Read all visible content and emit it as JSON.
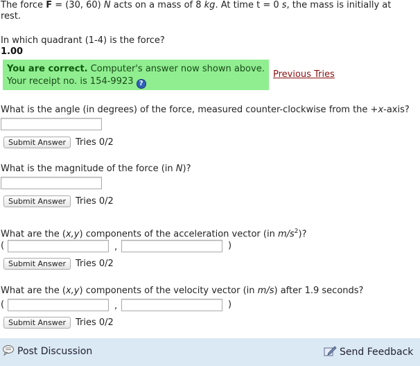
{
  "problem": {
    "line1_pre": "The force ",
    "force_symbol": "F",
    "line1_mid": " = (30, 60) ",
    "force_unit": "N",
    "line1_mid2": " acts on a mass of 8 ",
    "mass_unit": "kg",
    "line1_mid3": ". At time t = 0 ",
    "time_unit": "s",
    "line1_post": ", the mass is initially at",
    "line2": "rest."
  },
  "q1": {
    "question": "In which quadrant (1-4) is the force?",
    "answer": "1.00",
    "feedback_strong": "You are correct.",
    "feedback_rest": " Computer's answer now shown above.",
    "receipt": "Your receipt no. is 154-9923",
    "help_glyph": "?",
    "previous_tries": "Previous Tries"
  },
  "q2": {
    "question_pre": "What is the angle (in degrees) of the force, measured counter-clockwise from the +",
    "axis_var": "x",
    "question_post": "-axis?",
    "input_value": "",
    "submit_label": "Submit Answer",
    "tries": "Tries 0/2"
  },
  "q3": {
    "question_pre": "What is the magnitude of the force (in ",
    "unit": "N",
    "question_post": ")?",
    "input_value": "",
    "submit_label": "Submit Answer",
    "tries": "Tries 0/2"
  },
  "q4": {
    "question_pre": "What are the (",
    "vars": "x,y",
    "question_mid": ") components of the acceleration vector (in ",
    "unit_base": "m/s",
    "unit_exp": "2",
    "question_post": ")?",
    "open_paren": "(",
    "comma": ",",
    "close_paren": ")",
    "input_x": "",
    "input_y": "",
    "submit_label": "Submit Answer",
    "tries": "Tries 0/2"
  },
  "q5": {
    "question_pre": "What are the (",
    "vars": "x,y",
    "question_mid": ") components of the velocity vector (in ",
    "unit": "m/s",
    "question_post": ") after 1.9 seconds?",
    "open_paren": "(",
    "comma": ",",
    "close_paren": ")",
    "input_x": "",
    "input_y": "",
    "submit_label": "Submit Answer",
    "tries": "Tries 0/2"
  },
  "footer": {
    "post_discussion": "Post Discussion",
    "send_feedback": "Send Feedback",
    "post_icon": "speech-bubble-icon",
    "feedback_icon": "pencil-paper-icon"
  }
}
